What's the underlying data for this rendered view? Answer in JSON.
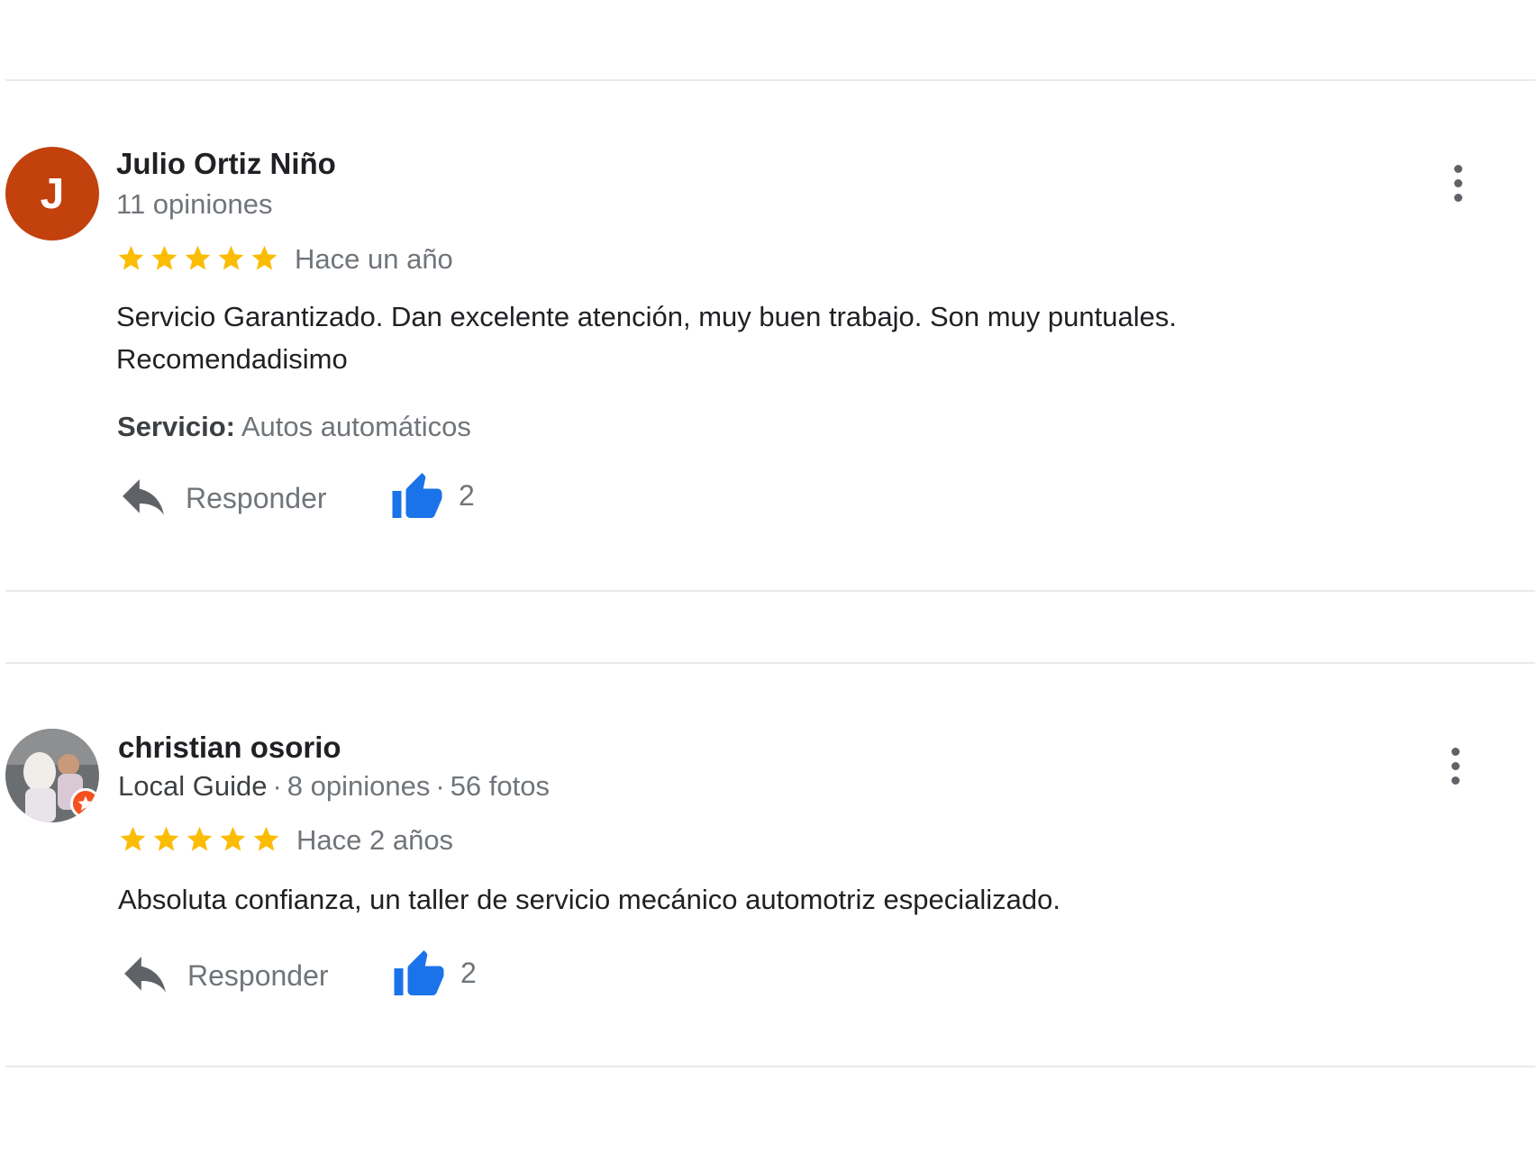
{
  "colors": {
    "accent": "#1a73e8",
    "star": "#fbbc04",
    "avatar_bg": "#c2410c",
    "badge": "#f4511e"
  },
  "reviews": [
    {
      "avatar_letter": "J",
      "name": "Julio Ortiz Niño",
      "reviews_count": "11 opiniones",
      "rating": 5,
      "date": "Hace un año",
      "text_line1": "Servicio Garantizado. Dan excelente atención, muy buen trabajo. Son muy puntuales.",
      "text_line2": "Recomendadisimo",
      "service_label": "Servicio:",
      "service_value": "Autos automáticos",
      "reply_label": "Responder",
      "likes": "2",
      "icons": [
        "more-vert-icon",
        "star-icon",
        "reply-icon",
        "thumb-up-icon"
      ]
    },
    {
      "name": "christian osorio",
      "local_guide": "Local Guide",
      "reviews_count": "8 opiniones",
      "photos_count": "56 fotos",
      "separator": "·",
      "rating": 5,
      "date": "Hace 2 años",
      "text_line1": "Absoluta confianza, un taller de servicio mecánico automotriz especializado.",
      "reply_label": "Responder",
      "likes": "2",
      "icons": [
        "more-vert-icon",
        "local-guide-badge-icon",
        "star-icon",
        "reply-icon",
        "thumb-up-icon"
      ]
    }
  ]
}
